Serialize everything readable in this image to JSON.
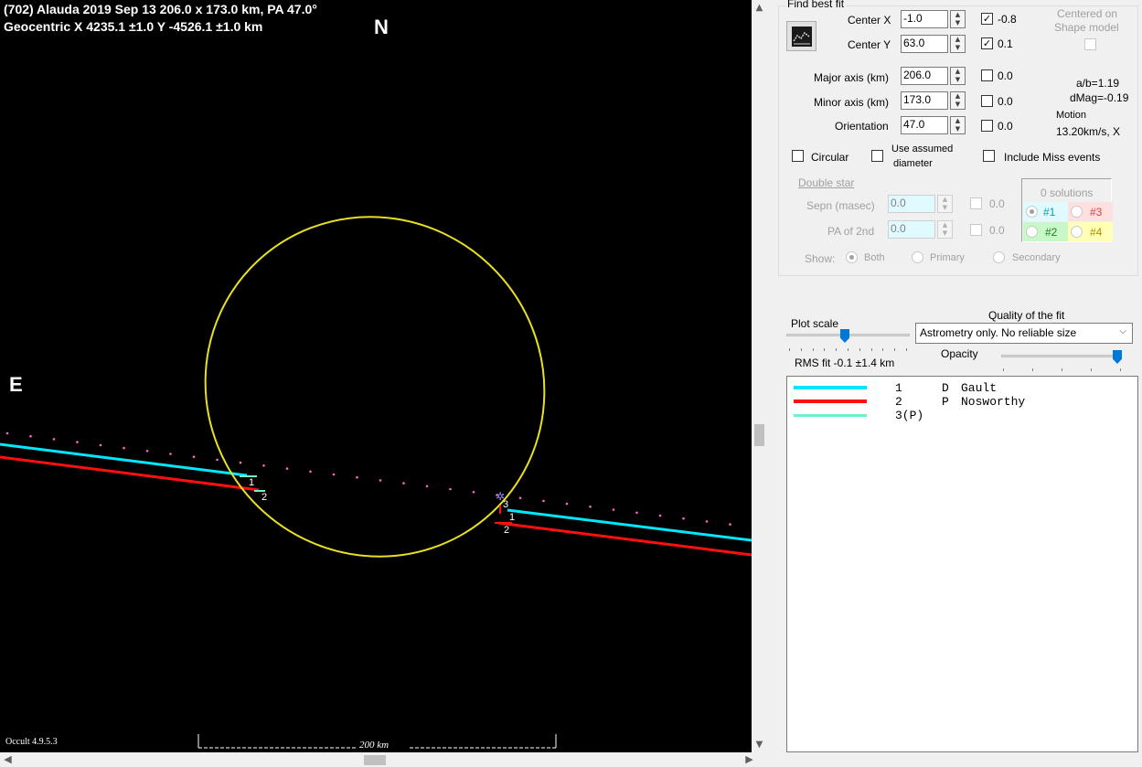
{
  "plot": {
    "title_line1": "(702) Alauda  2019 Sep 13  206.0 x 173.0 km, PA 47.0°",
    "title_line2": "Geocentric  X  4235.1 ±1.0  Y -4526.1 ±1.0 km",
    "north_label": "N",
    "east_label": "E",
    "version": "Occult 4.9.5.3",
    "scale_label": "200 km",
    "chord_labels": {
      "left_top": "1",
      "left_bottom": "2",
      "right_a": "3",
      "right_b": "1",
      "right_c": "2"
    },
    "colors": {
      "background": "#000000",
      "ellipse": "#e8e020",
      "chord1": "#00e8ff",
      "chord2": "#ff1010",
      "chord3": "#70f0c8",
      "path_dots": "#ff66cc"
    }
  },
  "panel": {
    "find_best_fit": "Find best fit",
    "center_x": {
      "label": "Center X",
      "value": "-1.0",
      "delta": "-0.8",
      "checked": true
    },
    "center_y": {
      "label": "Center Y",
      "value": "63.0",
      "delta": "0.1",
      "checked": true
    },
    "centered_on": {
      "line1": "Centered on",
      "line2": "Shape model"
    },
    "major_axis": {
      "label": "Major axis (km)",
      "value": "206.0",
      "delta": "0.0"
    },
    "minor_axis": {
      "label": "Minor axis (km)",
      "value": "173.0",
      "delta": "0.0"
    },
    "orientation": {
      "label": "Orientation",
      "value": "47.0",
      "delta": "0.0"
    },
    "ratio": "a/b=1.19",
    "dmag": "dMag=-0.19",
    "motion_label": "Motion",
    "motion_value": "13.20km/s, X",
    "circular": "Circular",
    "use_assumed_line1": "Use assumed",
    "use_assumed_line2": "diameter",
    "include_miss": "Include Miss events",
    "double_star": "Double star",
    "sepn": {
      "label": "Sepn (masec)",
      "value": "0.0",
      "delta": "0.0"
    },
    "pa2nd": {
      "label": "PA of 2nd",
      "value": "0.0",
      "delta": "0.0"
    },
    "solutions": {
      "title": "0 solutions",
      "s1": "#1",
      "s2": "#2",
      "s3": "#3",
      "s4": "#4"
    },
    "show": {
      "label": "Show:",
      "both": "Both",
      "primary": "Primary",
      "secondary": "Secondary"
    },
    "quality_label": "Quality of the fit",
    "plot_scale": "Plot scale",
    "quality_value": "Astrometry only. No reliable size",
    "opacity": "Opacity",
    "rms": "RMS fit -0.1 ±1.4 km",
    "plot_scale_level": 0.24,
    "opacity_level": 1.0
  },
  "observers": [
    {
      "num": "1",
      "code": "D",
      "name": "Gault",
      "color": "#00e8ff"
    },
    {
      "num": "2",
      "code": "P",
      "name": "Nosworthy",
      "color": "#ff1010"
    },
    {
      "num": "3(P)",
      "code": "",
      "name": "",
      "color": "#70f0c8"
    }
  ],
  "scroll": {
    "up": "▲",
    "down": "▼",
    "left": "◀",
    "right": "▶"
  }
}
